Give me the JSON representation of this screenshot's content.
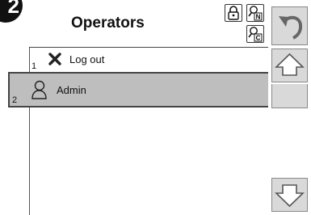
{
  "step": {
    "number": "2"
  },
  "header": {
    "title": "Operators",
    "lock_icon": "lock-icon",
    "search_name_icon": "search-n-icon",
    "search_code_icon": "search-c-icon",
    "search_name_letter": "N",
    "search_code_letter": "C"
  },
  "list": {
    "items": [
      {
        "number": "1",
        "label": "Log out",
        "icon": "close-icon"
      },
      {
        "number": "2",
        "label": "Admin",
        "icon": "user-icon",
        "selected": true
      }
    ]
  },
  "side": {
    "back_icon": "undo-arrow-icon",
    "up_icon": "arrow-up-icon",
    "down_icon": "arrow-down-icon"
  },
  "colors": {
    "selected_row": "#bebebe",
    "button_face": "#d9d9d9",
    "border": "#444444"
  }
}
